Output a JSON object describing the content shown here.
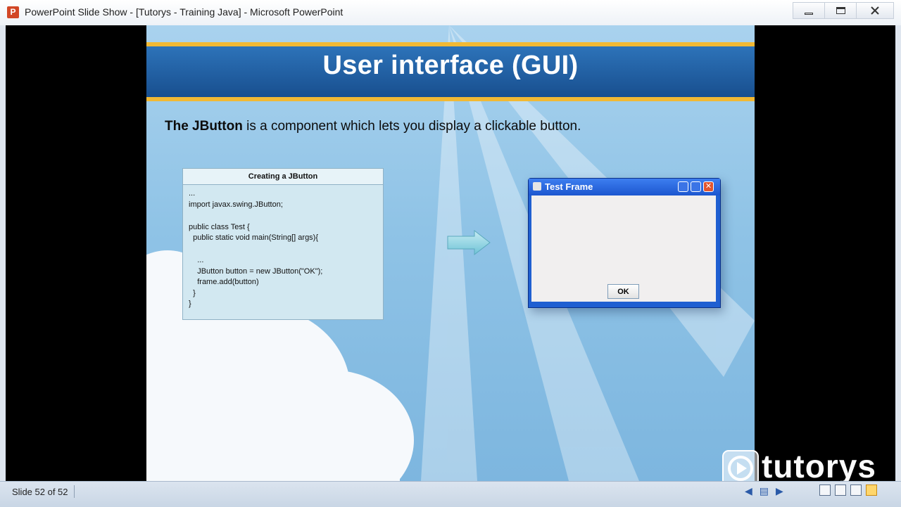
{
  "window": {
    "title": "PowerPoint Slide Show - [Tutorys - Training Java] - Microsoft PowerPoint",
    "app_icon_letter": "P"
  },
  "slide": {
    "title": "User interface (GUI)",
    "intro_bold": "The JButton",
    "intro_rest": " is a component which lets you display a clickable button.",
    "code_box": {
      "header": "Creating a JButton",
      "lines": [
        "...",
        "import javax.swing.JButton;",
        "",
        "public class Test {",
        "  public static void main(String[] args){",
        "",
        "",
        "    ...",
        "    JButton button = new JButton(\"OK\");",
        "    frame.add(button)",
        "  }",
        "}"
      ]
    },
    "java_window": {
      "title": "Test Frame",
      "button_label": "OK",
      "close_glyph": "✕"
    }
  },
  "logo": {
    "text": "tutorys"
  },
  "status": {
    "slide_counter": "Slide 52 of 52"
  },
  "colors": {
    "title_band": "#1f5fa6",
    "accent_yellow": "#f2b934",
    "slide_bg": "#8fc3e6"
  }
}
